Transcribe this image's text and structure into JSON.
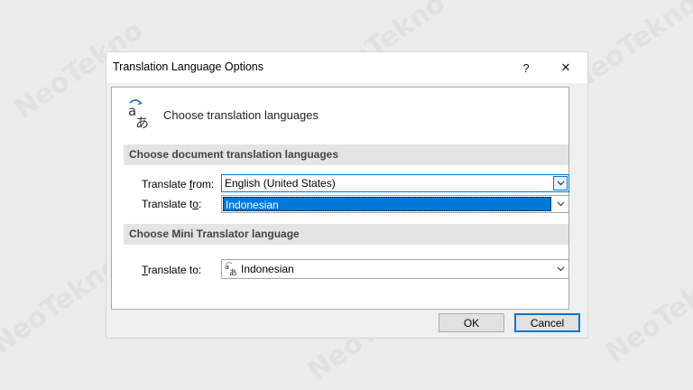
{
  "watermark": {
    "text": "NeoTekno"
  },
  "dialog": {
    "title": "Translation Language Options",
    "help_label": "?",
    "close_label": "✕",
    "header_text": "Choose translation languages",
    "doc_section": {
      "title": "Choose document translation languages",
      "from_label_pre": "Translate ",
      "from_label_key": "f",
      "from_label_post": "rom:",
      "from_value": "English (United States)",
      "to_label_pre": "Translate t",
      "to_label_key": "o",
      "to_label_post": ":",
      "to_value": "Indonesian"
    },
    "mini_section": {
      "title": "Choose Mini Translator language",
      "to_label_key": "T",
      "to_label_post": "ranslate to:",
      "to_value": "Indonesian"
    },
    "ok_label": "OK",
    "cancel_label": "Cancel"
  },
  "colors": {
    "accent": "#0078d7",
    "section_bg": "#e4e4e4",
    "dialog_bg": "#f0f0f0"
  },
  "icons": [
    "translate-icon",
    "help-icon",
    "close-icon",
    "chevron-down-icon"
  ]
}
